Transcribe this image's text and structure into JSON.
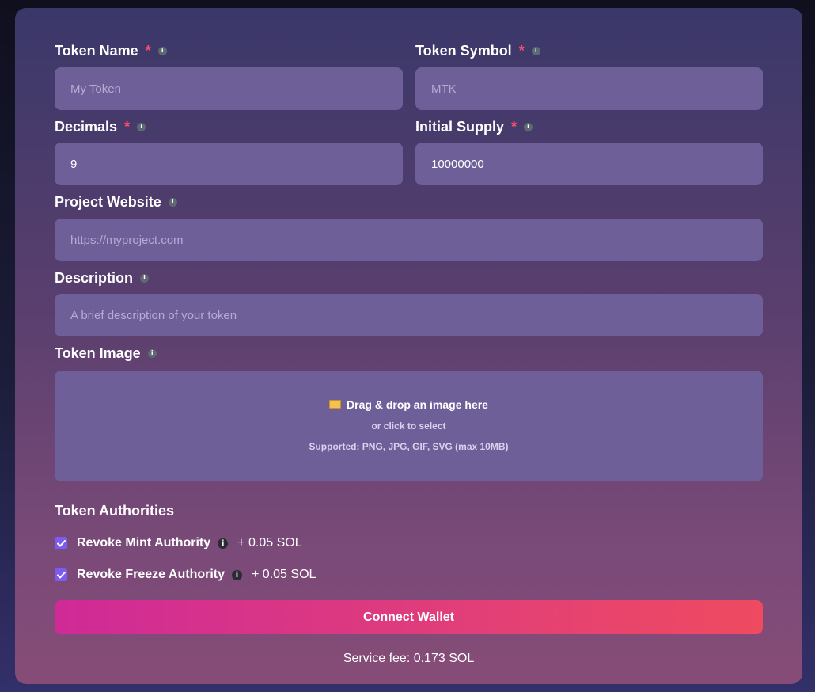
{
  "form": {
    "token_name": {
      "label": "Token Name",
      "required": "*",
      "info": "i",
      "placeholder": "My Token",
      "value": ""
    },
    "token_symbol": {
      "label": "Token Symbol",
      "required": "*",
      "info": "i",
      "placeholder": "MTK",
      "value": ""
    },
    "decimals": {
      "label": "Decimals",
      "required": "*",
      "info": "i",
      "value": "9"
    },
    "initial_supply": {
      "label": "Initial Supply",
      "required": "*",
      "info": "i",
      "value": "10000000"
    },
    "project_website": {
      "label": "Project Website",
      "info": "i",
      "placeholder": "https://myproject.com",
      "value": ""
    },
    "description": {
      "label": "Description",
      "info": "i",
      "placeholder": "A brief description of your token",
      "value": ""
    },
    "token_image": {
      "label": "Token Image",
      "info": "i",
      "drop_text": "Drag & drop an image here",
      "sub_text": "or click to select",
      "supported": "Supported: PNG, JPG, GIF, SVG (max 10MB)"
    }
  },
  "authorities": {
    "title": "Token Authorities",
    "items": [
      {
        "label": "Revoke Mint Authority",
        "info": "i",
        "price": "+ 0.05 SOL",
        "checked": true
      },
      {
        "label": "Revoke Freeze Authority",
        "info": "i",
        "price": "+ 0.05 SOL",
        "checked": true
      }
    ]
  },
  "actions": {
    "connect_label": "Connect Wallet"
  },
  "footer": {
    "fee": "Service fee: 0.173 SOL"
  },
  "colors": {
    "accent_start": "#cf2a97",
    "accent_end": "#ef4a60",
    "checkbox": "#7c5cf0",
    "required": "#ff4d6d"
  },
  "icons": {
    "folder": "folder-icon",
    "info": "info-icon",
    "check": "check-icon"
  }
}
